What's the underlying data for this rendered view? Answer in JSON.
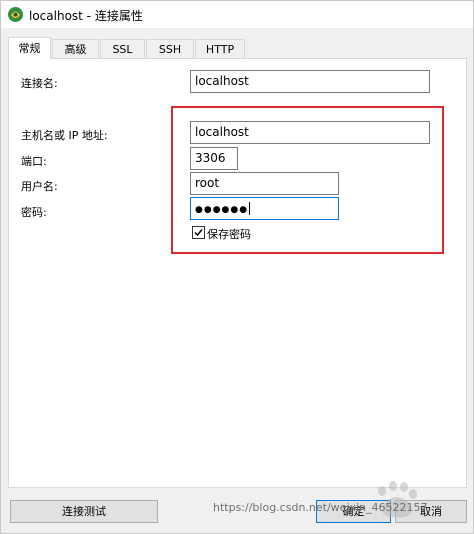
{
  "window": {
    "title": "localhost - 连接属性"
  },
  "tabs": [
    {
      "label": "常规"
    },
    {
      "label": "高级"
    },
    {
      "label": "SSL"
    },
    {
      "label": "SSH"
    },
    {
      "label": "HTTP"
    }
  ],
  "form": {
    "connection_name": {
      "label": "连接名:",
      "value": "localhost"
    },
    "host": {
      "label": "主机名或 IP 地址:",
      "value": "localhost"
    },
    "port": {
      "label": "端口:",
      "value": "3306"
    },
    "username": {
      "label": "用户名:",
      "value": "root"
    },
    "password": {
      "label": "密码:",
      "value": "●●●●●●"
    },
    "save_password": {
      "label": "保存密码",
      "checked": true
    }
  },
  "buttons": {
    "test": "连接测试",
    "ok": "确定",
    "cancel": "取消"
  },
  "watermark": {
    "text": "https://blog.csdn.net/weixin_46522157"
  },
  "colors": {
    "highlight": "#d92b30",
    "focus": "#0078d7"
  }
}
